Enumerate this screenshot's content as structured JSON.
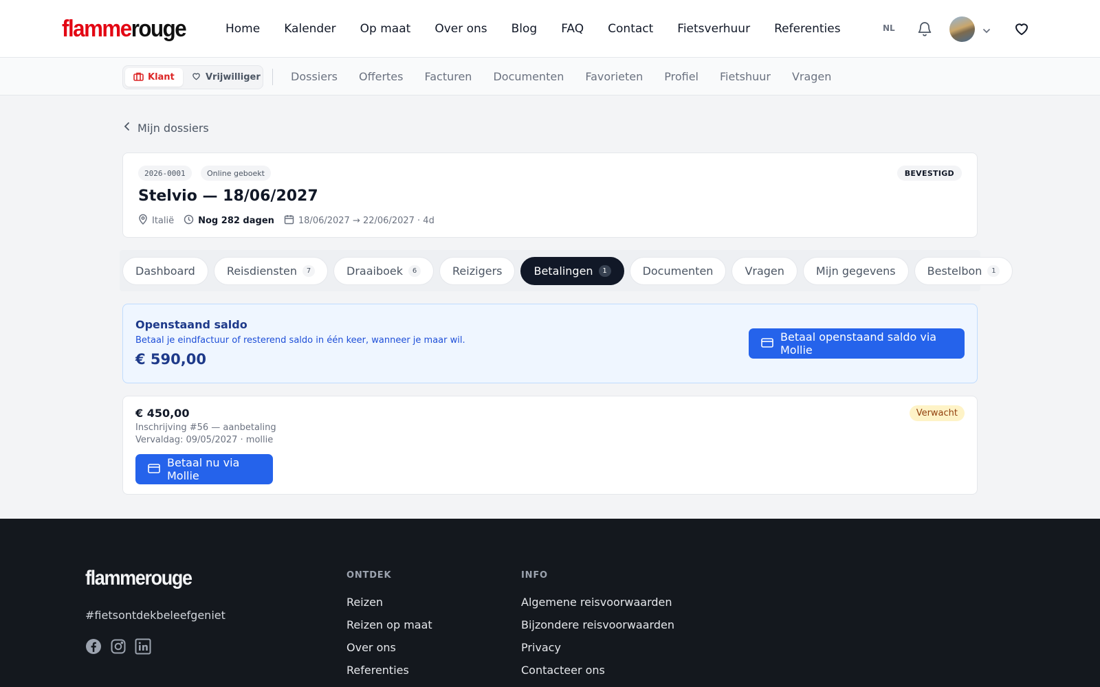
{
  "header": {
    "logo_part1": "flamme",
    "logo_part2": "rouge",
    "nav": [
      "Home",
      "Kalender",
      "Op maat",
      "Over ons",
      "Blog",
      "FAQ",
      "Contact",
      "Fietsverhuur",
      "Referenties"
    ],
    "lang": "NL",
    "icons": [
      "bell-icon",
      "avatar",
      "chevron-down-icon",
      "heart-icon"
    ]
  },
  "subnav": {
    "role_klant": "Klant",
    "role_vrijwilliger": "Vrijwilliger",
    "items": [
      "Dossiers",
      "Offertes",
      "Facturen",
      "Documenten",
      "Favorieten",
      "Profiel",
      "Fietshuur",
      "Vragen"
    ]
  },
  "back_link": "Mijn dossiers",
  "dossier": {
    "code": "2026-0001",
    "channel": "Online geboekt",
    "status": "BEVESTIGD",
    "title": "Stelvio — 18/06/2027",
    "country": "Italië",
    "countdown": "Nog 282 dagen",
    "dates": "18/06/2027 → 22/06/2027 · 4d"
  },
  "tabs": [
    {
      "label": "Dashboard",
      "count": ""
    },
    {
      "label": "Reisdiensten",
      "count": "7"
    },
    {
      "label": "Draaiboek",
      "count": "6"
    },
    {
      "label": "Reizigers",
      "count": ""
    },
    {
      "label": "Betalingen",
      "count": "1"
    },
    {
      "label": "Documenten",
      "count": ""
    },
    {
      "label": "Vragen",
      "count": ""
    },
    {
      "label": "Mijn gegevens",
      "count": ""
    },
    {
      "label": "Bestelbon",
      "count": "1"
    }
  ],
  "active_tab": "Betalingen",
  "saldo": {
    "title": "Openstaand saldo",
    "subtitle": "Betaal je eindfactuur of resterend saldo in één keer, wanneer je maar wil.",
    "amount": "€ 590,00",
    "button": "Betaal openstaand saldo via Mollie"
  },
  "payment": {
    "amount": "€ 450,00",
    "line1": "Inschrijving #56 — aanbetaling",
    "line2": "Vervaldag: 09/05/2027 · mollie",
    "status": "Verwacht",
    "button": "Betaal nu via Mollie"
  },
  "footer": {
    "logo": "flammerouge",
    "tagline": "#fietsontdekbeleefgeniet",
    "col1_title": "ONTDEK",
    "col1_links": [
      "Reizen",
      "Reizen op maat",
      "Over ons",
      "Referenties"
    ],
    "col2_title": "INFO",
    "col2_links": [
      "Algemene reisvoorwaarden",
      "Bijzondere reisvoorwaarden",
      "Privacy",
      "Contacteer ons"
    ],
    "social": [
      "facebook-icon",
      "instagram-icon",
      "linkedin-icon"
    ]
  },
  "colors": {
    "brand_red": "#e30613",
    "primary_blue": "#2563eb",
    "dark": "#111827",
    "footer_bg": "#14181e"
  }
}
